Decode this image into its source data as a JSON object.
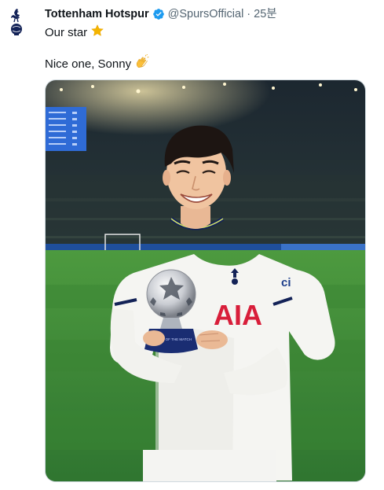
{
  "tweet": {
    "display_name": "Tottenham Hotspur",
    "handle": "@SpursOfficial",
    "separator": "·",
    "time": "25분",
    "line1": "Our star",
    "line2": "Nice one, Sonny"
  },
  "icons": {
    "avatar": "tottenham-cockerel-logo",
    "verified": "verified-badge-icon",
    "star": "star-emoji",
    "clap": "clapping-hands-emoji"
  },
  "media": {
    "description_icon": "photo",
    "trophy_text": "PLAYER OF THE MATCH",
    "shirt_sponsor": "AIA"
  },
  "colors": {
    "text": "#0f1419",
    "secondary": "#536471",
    "verified_blue": "#1d9bf0",
    "pitch_green": "#3f8a3a",
    "spurs_navy": "#132257"
  }
}
